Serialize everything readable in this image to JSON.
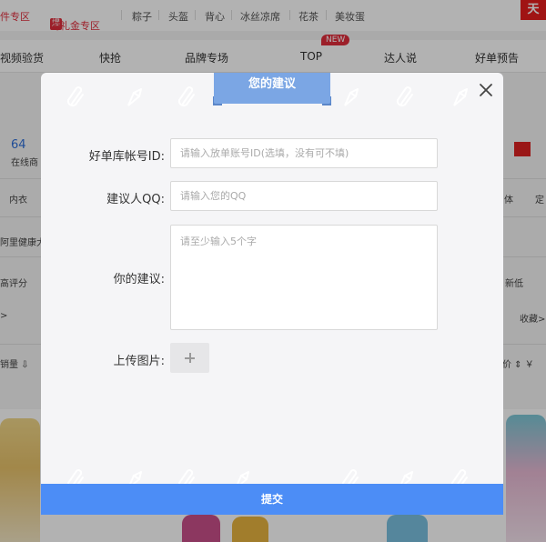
{
  "top_links": {
    "first": "件专区",
    "second_badge": "爆",
    "second": "淘礼金专区",
    "items": [
      "粽子",
      "头盔",
      "背心",
      "冰丝凉席",
      "花茶",
      "美妆蛋"
    ],
    "corner": "天"
  },
  "nav": {
    "items": [
      "视频验货",
      "快抢",
      "品牌专场",
      "TOP",
      "达人说",
      "好单预告"
    ],
    "new_badge": "NEW"
  },
  "background": {
    "online_count": "64",
    "online_label": "在线商",
    "category_left": "内衣",
    "category_right_1": "体",
    "category_right_2": "定",
    "health_text": "阿里健康大",
    "sort_rating": "高评分",
    "sort_new": "新低",
    "fav": "收藏>",
    "arrow": ">",
    "sales_sort": "销量 ⇩",
    "price_sort": "价 ⇕ ￥"
  },
  "modal": {
    "title": "您的建议",
    "fields": {
      "account": {
        "label": "好单库帐号ID:",
        "placeholder": "请输入放单账号ID(选填，没有可不填)",
        "value": ""
      },
      "qq": {
        "label": "建议人QQ:",
        "placeholder": "请输入您的QQ",
        "value": ""
      },
      "suggestion": {
        "label": "你的建议:",
        "placeholder": "请至少输入5个字",
        "value": ""
      },
      "upload": {
        "label": "上传图片:"
      }
    },
    "submit_label": "提交"
  },
  "colors": {
    "accent": "#4c8df6",
    "ribbon": "#7ba6e4",
    "brand_red": "#e02d3c"
  },
  "icons": {
    "close": "close-icon",
    "upload": "plus-icon",
    "decoration": [
      "paperclip-icon",
      "pen-nib-icon"
    ]
  }
}
